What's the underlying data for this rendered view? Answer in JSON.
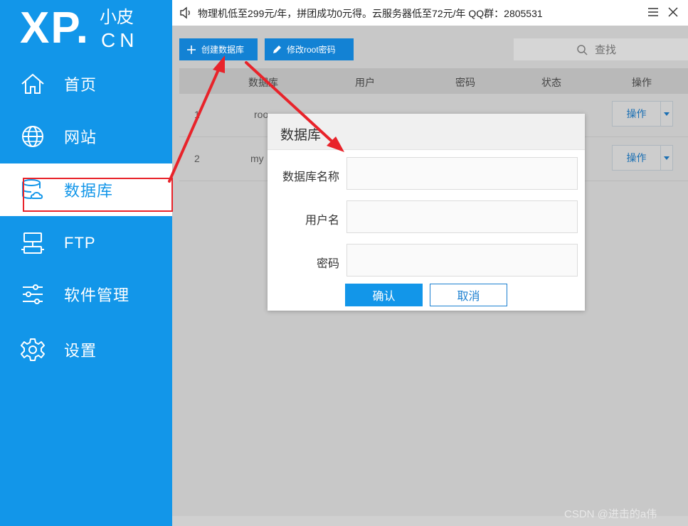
{
  "logo": {
    "main": "XP.",
    "small": "小皮",
    "cn": "CN"
  },
  "sidebar": {
    "items": [
      {
        "label": "首页",
        "icon": "home-icon"
      },
      {
        "label": "网站",
        "icon": "globe-icon"
      },
      {
        "label": "数据库",
        "icon": "database-icon",
        "active": true
      },
      {
        "label": "FTP",
        "icon": "ftp-server-icon"
      },
      {
        "label": "软件管理",
        "icon": "sliders-icon"
      },
      {
        "label": "设置",
        "icon": "gear-icon"
      }
    ]
  },
  "topbar": {
    "notice": "物理机低至299元/年，拼团成功0元得。云服务器低至72元/年  QQ群：2805531"
  },
  "toolbar": {
    "create_label": "创建数据库",
    "modify_label": "修改root密码",
    "search_placeholder": "查找"
  },
  "table": {
    "columns": [
      "数据库",
      "用户",
      "密码",
      "状态",
      "操作"
    ],
    "rows": [
      {
        "index": "1",
        "name": "roo",
        "action": "操作"
      },
      {
        "index": "2",
        "name": "my",
        "action": "操作"
      }
    ]
  },
  "modal": {
    "title": "数据库",
    "fields": [
      {
        "label": "数据库名称",
        "value": ""
      },
      {
        "label": "用户名",
        "value": ""
      },
      {
        "label": "密码",
        "value": ""
      }
    ],
    "confirm_label": "确认",
    "cancel_label": "取消"
  },
  "watermark": "CSDN @进击的a伟",
  "colors": {
    "primary": "#1296e9",
    "button": "#1382d4",
    "annotation": "#e8232a"
  }
}
